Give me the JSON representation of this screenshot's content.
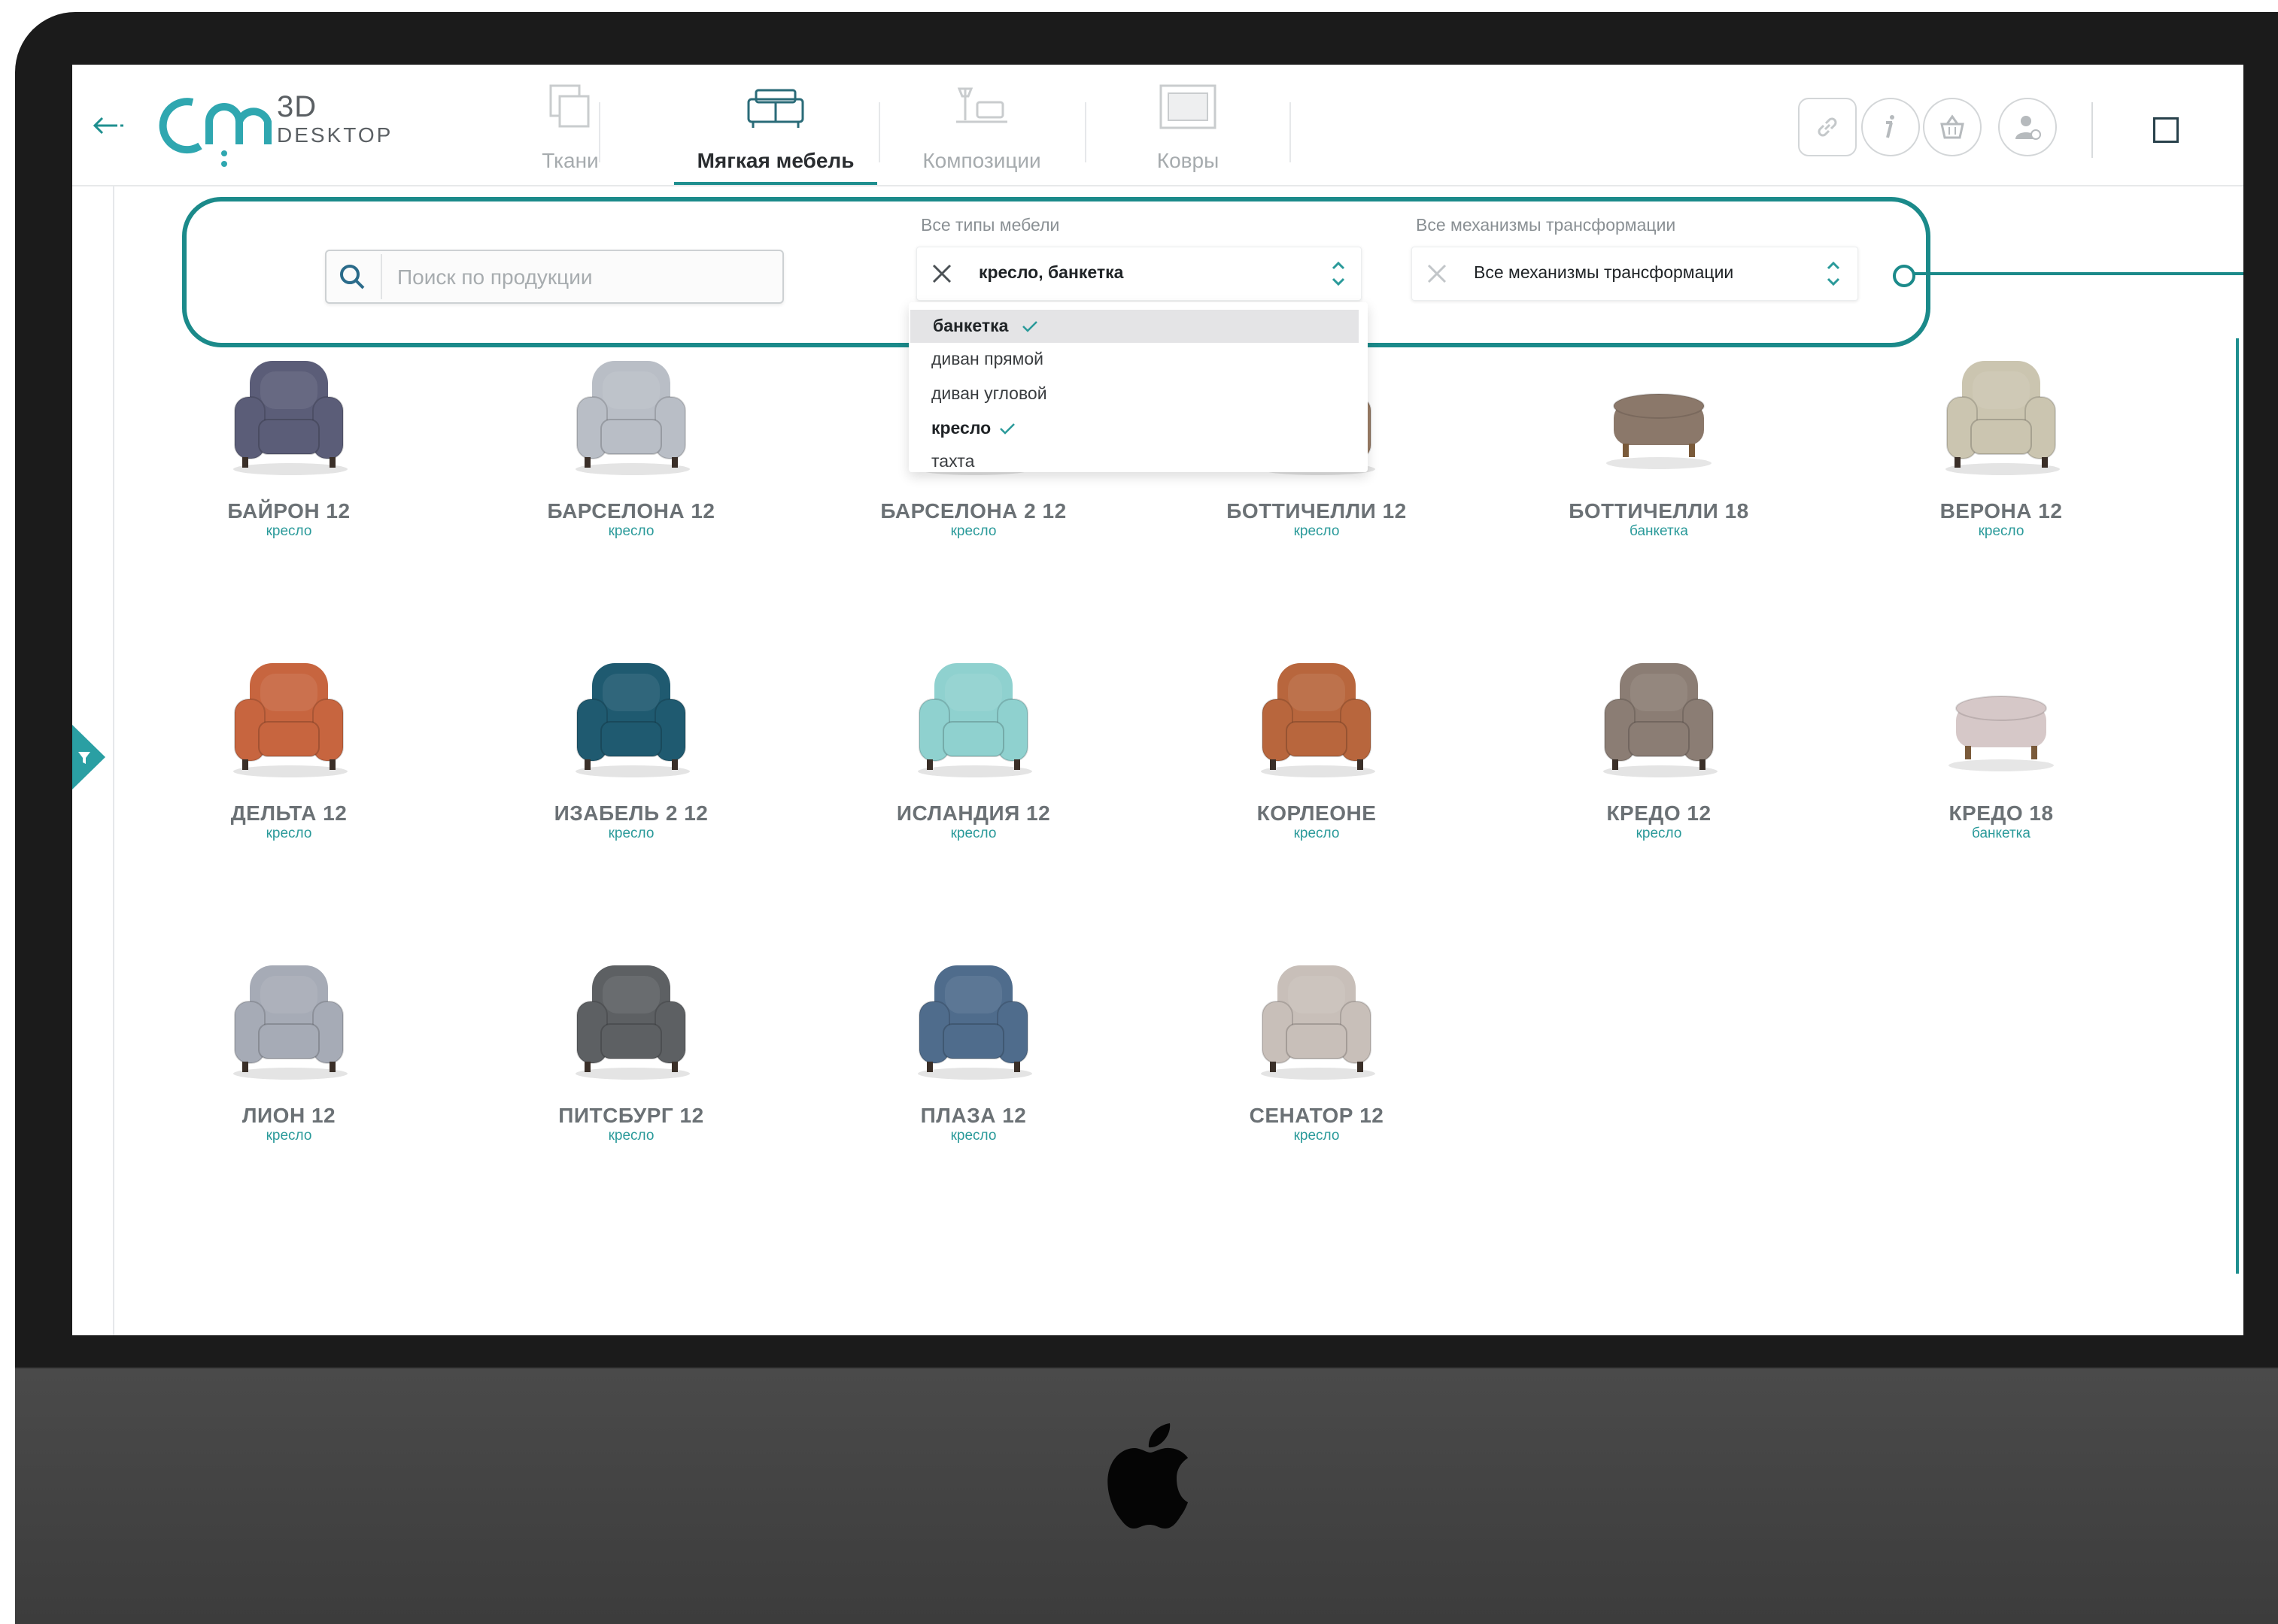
{
  "header": {
    "logo": {
      "brand": "om",
      "line1": "3D",
      "line2": "DESKTOP"
    },
    "tabs": [
      {
        "label": "Ткани",
        "icon": "fabric-icon",
        "active": false
      },
      {
        "label": "Мягкая мебель",
        "icon": "sofa-icon",
        "active": true
      },
      {
        "label": "Композиции",
        "icon": "composition-icon",
        "active": false
      },
      {
        "label": "Ковры",
        "icon": "carpet-icon",
        "active": false
      }
    ],
    "tools": [
      "link-icon",
      "info-icon",
      "basket-icon",
      "user-icon"
    ]
  },
  "filters": {
    "search_placeholder": "Поиск по продукции",
    "type_caption": "Все типы мебели",
    "type_value": "кресло, банкетка",
    "mechanism_caption": "Все механизмы трансформации",
    "mechanism_value": "Все механизмы трансформации",
    "type_options": [
      {
        "label": "банкетка",
        "selected": true
      },
      {
        "label": "диван прямой",
        "selected": false
      },
      {
        "label": "диван угловой",
        "selected": false
      },
      {
        "label": "кресло",
        "selected": true
      },
      {
        "label": "тахта",
        "selected": false
      }
    ]
  },
  "products": [
    {
      "name": "БАЙРОН 12",
      "type": "кресло",
      "color": "#5b5d78"
    },
    {
      "name": "БАРСЕЛОНА 12",
      "type": "кресло",
      "color": "#b9bec6"
    },
    {
      "name": "БАРСЕЛОНА 2 12",
      "type": "кресло",
      "color": "#c2c6cc"
    },
    {
      "name": "БОТТИЧЕЛЛИ 12",
      "type": "кресло",
      "color": "#9c7e66"
    },
    {
      "name": "БОТТИЧЕЛЛИ 18",
      "type": "банкетка",
      "color": "#8b786a"
    },
    {
      "name": "ВЕРОНА 12",
      "type": "кресло",
      "color": "#cbc5b0"
    },
    {
      "name": "ДЕЛЬТА 12",
      "type": "кресло",
      "color": "#c7653f"
    },
    {
      "name": "ИЗАБЕЛЬ 2 12",
      "type": "кресло",
      "color": "#1f5a70"
    },
    {
      "name": "ИСЛАНДИЯ 12",
      "type": "кресло",
      "color": "#8fd1cf"
    },
    {
      "name": "КОРЛЕОНЕ",
      "type": "кресло",
      "color": "#b8663d"
    },
    {
      "name": "КРЕДО 12",
      "type": "кресло",
      "color": "#8b7d74"
    },
    {
      "name": "КРЕДО 18",
      "type": "банкетка",
      "color": "#d6c8c8"
    },
    {
      "name": "ЛИОН 12",
      "type": "кресло",
      "color": "#a6abb6"
    },
    {
      "name": "ПИТСБУРГ 12",
      "type": "кресло",
      "color": "#5d6063"
    },
    {
      "name": "ПЛАЗА 12",
      "type": "кресло",
      "color": "#4f6c8c"
    },
    {
      "name": "СЕНАТОР 12",
      "type": "кресло",
      "color": "#c8bfb9"
    }
  ],
  "colors": {
    "accent": "#1b8a8a",
    "text_dark": "#1f2326",
    "text_muted": "#6b7175"
  }
}
